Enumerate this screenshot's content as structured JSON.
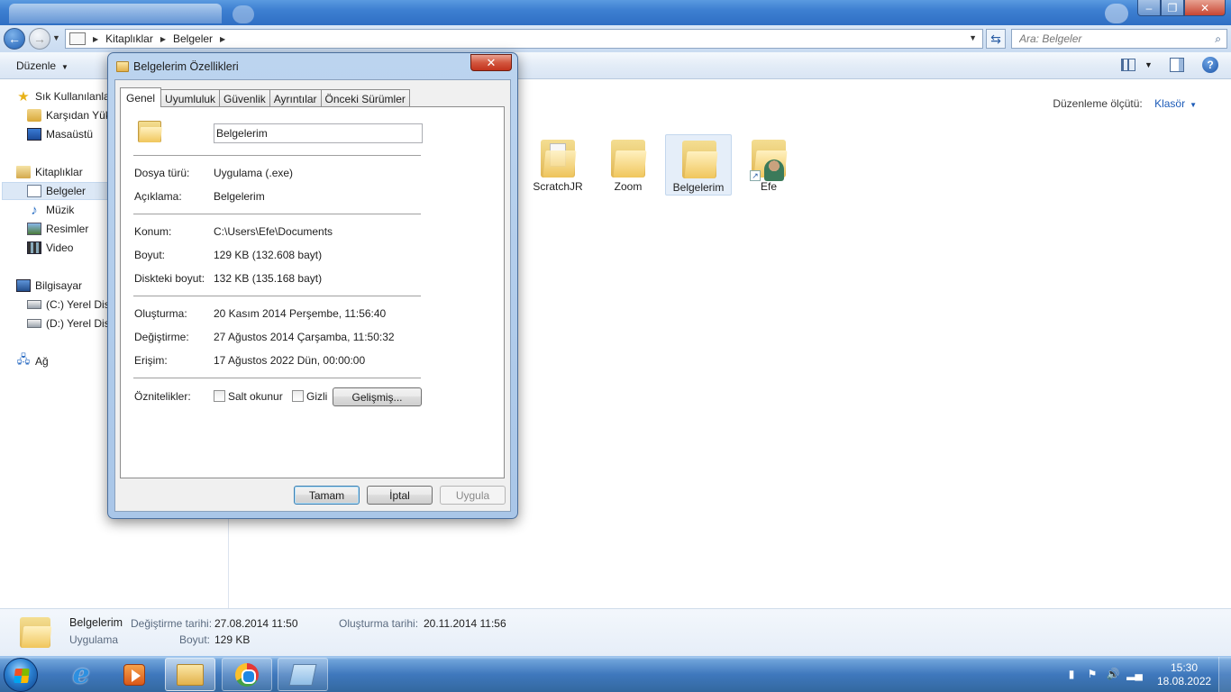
{
  "address": {
    "crumbs": [
      "Kitaplıklar",
      "Belgeler"
    ],
    "search_placeholder": "Ara: Belgeler"
  },
  "toolbar": {
    "organize_label": "Düzenle"
  },
  "navpane": {
    "favorites_label": "Sık Kullanılanlar",
    "downloads_label": "Karşıdan Yükl",
    "desktop_label": "Masaüstü",
    "libraries_label": "Kitaplıklar",
    "documents_label": "Belgeler",
    "music_label": "Müzik",
    "pictures_label": "Resimler",
    "videos_label": "Video",
    "computer_label": "Bilgisayar",
    "drive_c_label": "(C:) Yerel Disk",
    "drive_d_label": "(D:) Yerel Disk",
    "network_label": "Ağ"
  },
  "content": {
    "arrange_label": "Düzenleme ölçütü:",
    "arrange_value": "Klasör",
    "files": [
      "ScratchJR",
      "Zoom",
      "Belgelerim",
      "Efe"
    ]
  },
  "details": {
    "name": "Belgelerim",
    "type": "Uygulama",
    "modified_key": "Değiştirme tarihi:",
    "modified_value": "27.08.2014 11:50",
    "created_key": "Oluşturma tarihi:",
    "created_value": "20.11.2014 11:56",
    "size_key": "Boyut:",
    "size_value": "129 KB"
  },
  "dialog": {
    "title": "Belgelerim Özellikleri",
    "tabs": [
      "Genel",
      "Uyumluluk",
      "Güvenlik",
      "Ayrıntılar",
      "Önceki Sürümler"
    ],
    "name_value": "Belgelerim",
    "file_type_label": "Dosya türü:",
    "file_type_value": "Uygulama (.exe)",
    "description_label": "Açıklama:",
    "description_value": "Belgelerim",
    "location_label": "Konum:",
    "location_value": "C:\\Users\\Efe\\Documents",
    "size_label": "Boyut:",
    "size_value": "129 KB (132.608 bayt)",
    "disk_size_label": "Diskteki boyut:",
    "disk_size_value": "132 KB (135.168 bayt)",
    "created_label": "Oluşturma:",
    "created_value": "20 Kasım 2014 Perşembe, 11:56:40",
    "modified_label": "Değiştirme:",
    "modified_value": "27 Ağustos 2014 Çarşamba, 11:50:32",
    "accessed_label": "Erişim:",
    "accessed_value": "17 Ağustos 2022 Dün, 00:00:00",
    "attributes_label": "Öznitelikler:",
    "readonly_label": "Salt okunur",
    "hidden_label": "Gizli",
    "advanced_button": "Gelişmiş...",
    "ok_button": "Tamam",
    "cancel_button": "İptal",
    "apply_button": "Uygula"
  },
  "taskbar": {
    "time": "15:30",
    "date": "18.08.2022"
  }
}
